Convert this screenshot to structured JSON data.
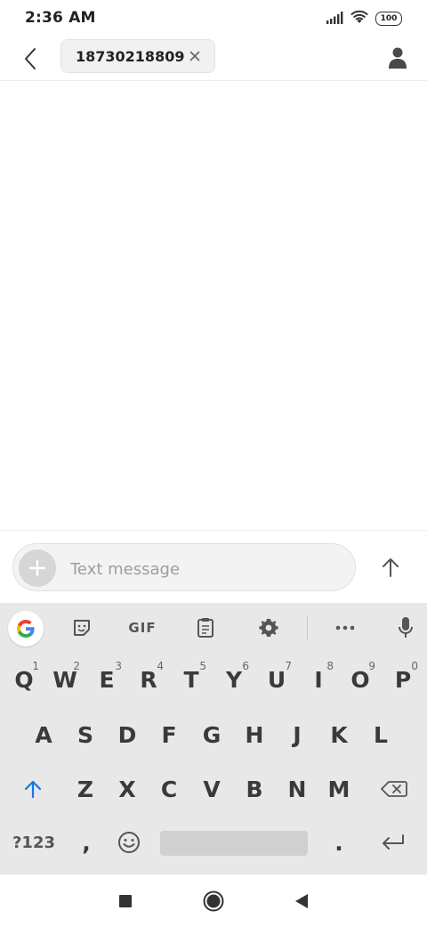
{
  "status_bar": {
    "time": "2:36 AM",
    "battery": "100",
    "icons": [
      "signal-icon",
      "wifi-icon",
      "battery-icon"
    ]
  },
  "header": {
    "recipient": "18730218809",
    "icons": [
      "back-arrow-icon",
      "close-icon",
      "contact-person-icon"
    ]
  },
  "compose": {
    "placeholder": "Text message",
    "value": "",
    "icons": [
      "plus-icon",
      "send-arrow-up-icon"
    ]
  },
  "keyboard": {
    "toolbar": {
      "gif_label": "GIF",
      "icons": [
        "google-g-icon",
        "sticker-icon",
        "clipboard-icon",
        "gear-icon",
        "more-dots-icon",
        "microphone-icon"
      ]
    },
    "row1": [
      {
        "label": "Q",
        "hint": "1"
      },
      {
        "label": "W",
        "hint": "2"
      },
      {
        "label": "E",
        "hint": "3"
      },
      {
        "label": "R",
        "hint": "4"
      },
      {
        "label": "T",
        "hint": "5"
      },
      {
        "label": "Y",
        "hint": "6"
      },
      {
        "label": "U",
        "hint": "7"
      },
      {
        "label": "I",
        "hint": "8"
      },
      {
        "label": "O",
        "hint": "9"
      },
      {
        "label": "P",
        "hint": "0"
      }
    ],
    "row2": [
      "A",
      "S",
      "D",
      "F",
      "G",
      "H",
      "J",
      "K",
      "L"
    ],
    "row3": [
      "Z",
      "X",
      "C",
      "V",
      "B",
      "N",
      "M"
    ],
    "symbols_label": "?123",
    "comma": ",",
    "period": ".",
    "icons": [
      "shift-arrow-icon",
      "backspace-icon",
      "emoji-icon",
      "enter-icon"
    ]
  },
  "nav_bar": {
    "icons": [
      "recents-square-icon",
      "home-circle-icon",
      "back-triangle-icon"
    ]
  },
  "colors": {
    "shift_accent": "#1a73e8",
    "keyboard_bg": "#e8e8e8"
  }
}
